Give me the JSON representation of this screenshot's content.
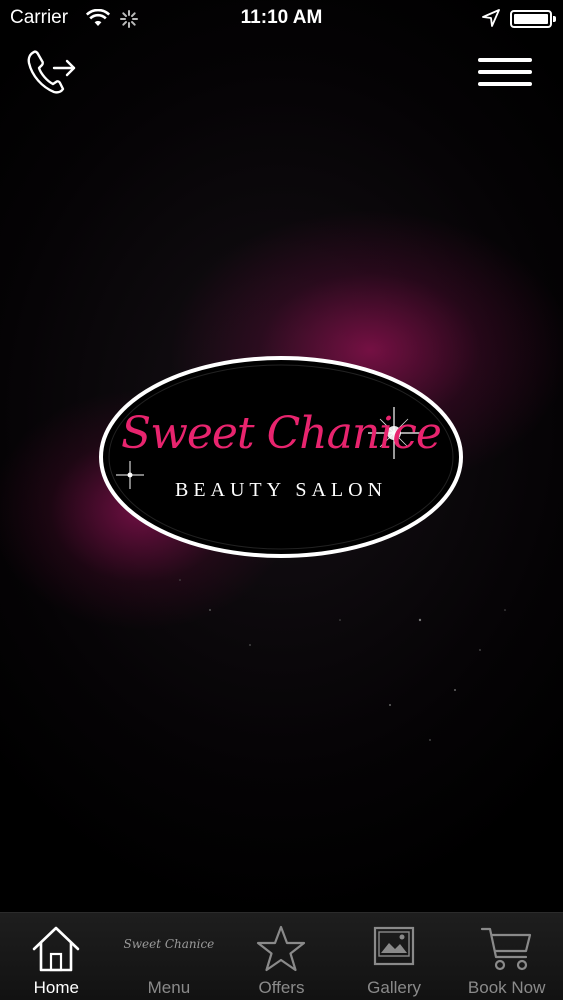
{
  "status_bar": {
    "carrier": "Carrier",
    "time": "11:10 AM",
    "icons": [
      "wifi-icon",
      "activity-spinner-icon",
      "location-arrow-icon",
      "battery-icon"
    ]
  },
  "top_nav": {
    "call_icon": "phone-forward-icon",
    "menu_icon": "hamburger-menu-icon"
  },
  "logo": {
    "wordmark": "Sweet Chanice",
    "subtitle": "BEAUTY SALON",
    "accent_color": "#e8246e"
  },
  "tab_bar": {
    "active_index": 0,
    "tabs": [
      {
        "label": "Home",
        "icon": "home-icon"
      },
      {
        "label": "Menu",
        "icon": "sweet-chanice-script-icon",
        "icon_text": "Sweet Chanice"
      },
      {
        "label": "Offers",
        "icon": "star-icon"
      },
      {
        "label": "Gallery",
        "icon": "image-icon"
      },
      {
        "label": "Book Now",
        "icon": "shopping-cart-icon"
      }
    ]
  }
}
